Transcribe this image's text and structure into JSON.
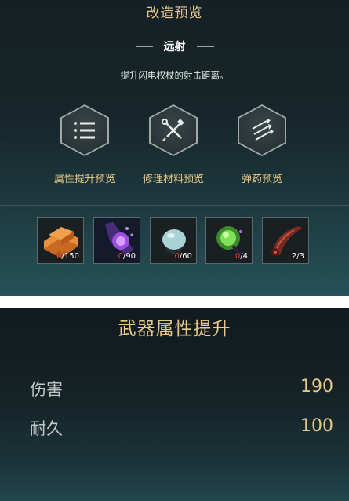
{
  "top": {
    "title": "改造预览",
    "subtitle": "远射",
    "description": "提升闪电权杖的射击距离。",
    "actions": [
      {
        "label": "属性提升预览",
        "icon": "list-icon"
      },
      {
        "label": "修理材料预览",
        "icon": "repair-tools-icon"
      },
      {
        "label": "弹药预览",
        "icon": "arrows-icon"
      }
    ],
    "items": [
      {
        "name": "wood-planks",
        "have": "0",
        "need": "/150"
      },
      {
        "name": "purple-potion",
        "have": "0",
        "need": "/90"
      },
      {
        "name": "blue-mushroom",
        "have": "0",
        "need": "/60"
      },
      {
        "name": "green-crystal",
        "have": "0",
        "need": "/4"
      },
      {
        "name": "red-horn",
        "have": "2",
        "need": "/3"
      }
    ]
  },
  "bottom": {
    "title": "武器属性提升",
    "stats": [
      {
        "name": "伤害",
        "value": "190"
      },
      {
        "name": "耐久",
        "value": "100"
      }
    ]
  },
  "colors": {
    "gold": "#e8c987",
    "shortage_red": "#ff4040",
    "panel_teal": "#1d3a3f"
  }
}
